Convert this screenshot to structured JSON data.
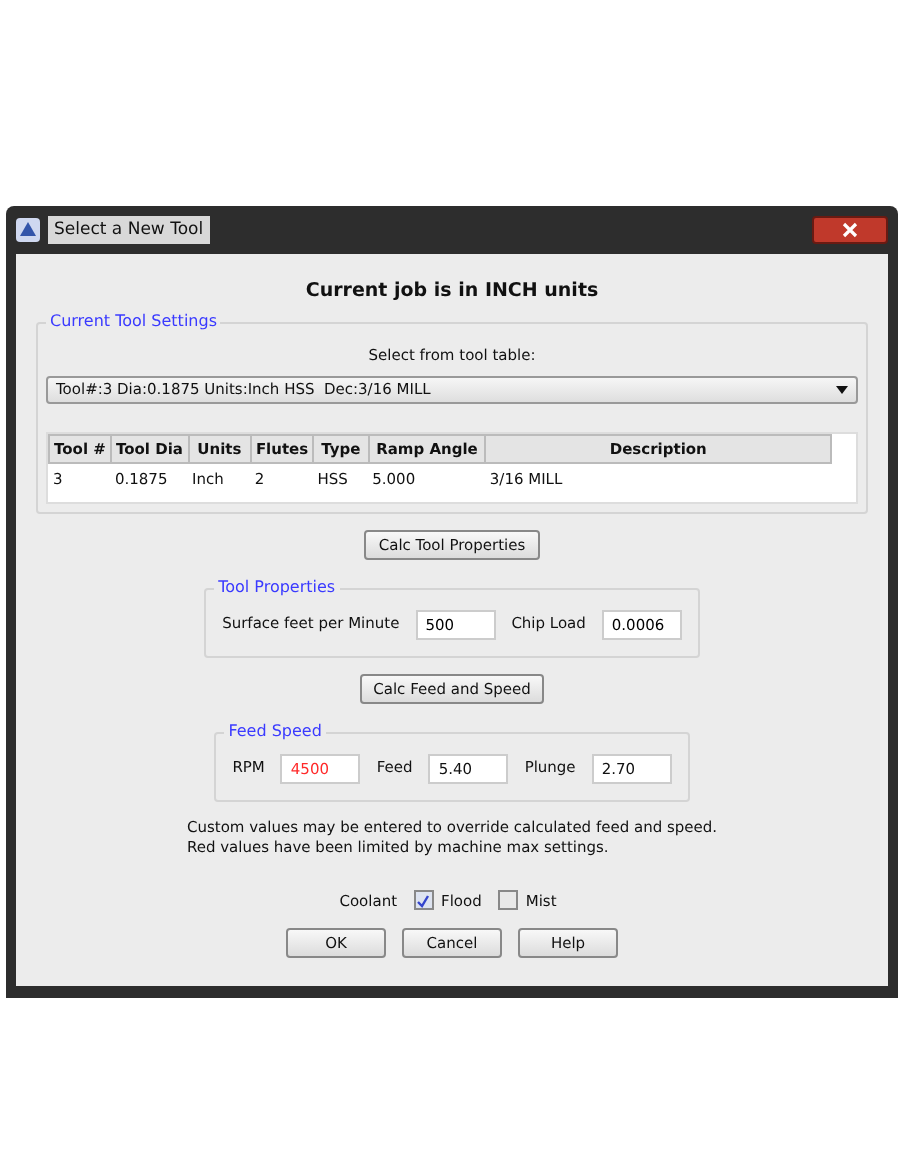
{
  "window": {
    "title": "Select a New Tool"
  },
  "heading": "Current job is in INCH units",
  "current_tool_settings": {
    "legend": "Current Tool Settings",
    "select_label": "Select from tool table:",
    "select_value": "Tool#:3 Dia:0.1875 Units:Inch HSS  Dec:3/16 MILL",
    "table": {
      "columns": [
        "Tool #",
        "Tool Dia",
        "Units",
        "Flutes",
        "Type",
        "Ramp Angle",
        "Description"
      ],
      "rows": [
        [
          "3",
          "0.1875",
          "Inch",
          "2",
          "HSS",
          "5.000",
          "3/16 MILL"
        ]
      ]
    }
  },
  "calc_tool_button": "Calc Tool Properties",
  "tool_properties": {
    "legend": "Tool Properties",
    "fields": [
      {
        "label": "Surface feet per Minute",
        "value": "500"
      },
      {
        "label": "Chip Load",
        "value": "0.0006"
      }
    ]
  },
  "calc_feed_button": "Calc Feed and Speed",
  "feed_speed": {
    "legend": "Feed Speed",
    "fields": [
      {
        "label": "RPM",
        "value": "4500",
        "limited": true
      },
      {
        "label": "Feed",
        "value": "5.40",
        "limited": false
      },
      {
        "label": "Plunge",
        "value": "2.70",
        "limited": false
      }
    ]
  },
  "notes": [
    "Custom values may be entered to override calculated feed and speed.",
    "Red values have been limited by machine max settings."
  ],
  "coolant": {
    "label": "Coolant",
    "options": [
      {
        "label": "Flood",
        "checked": true
      },
      {
        "label": "Mist",
        "checked": false
      }
    ]
  },
  "buttons": [
    "OK",
    "Cancel",
    "Help"
  ]
}
